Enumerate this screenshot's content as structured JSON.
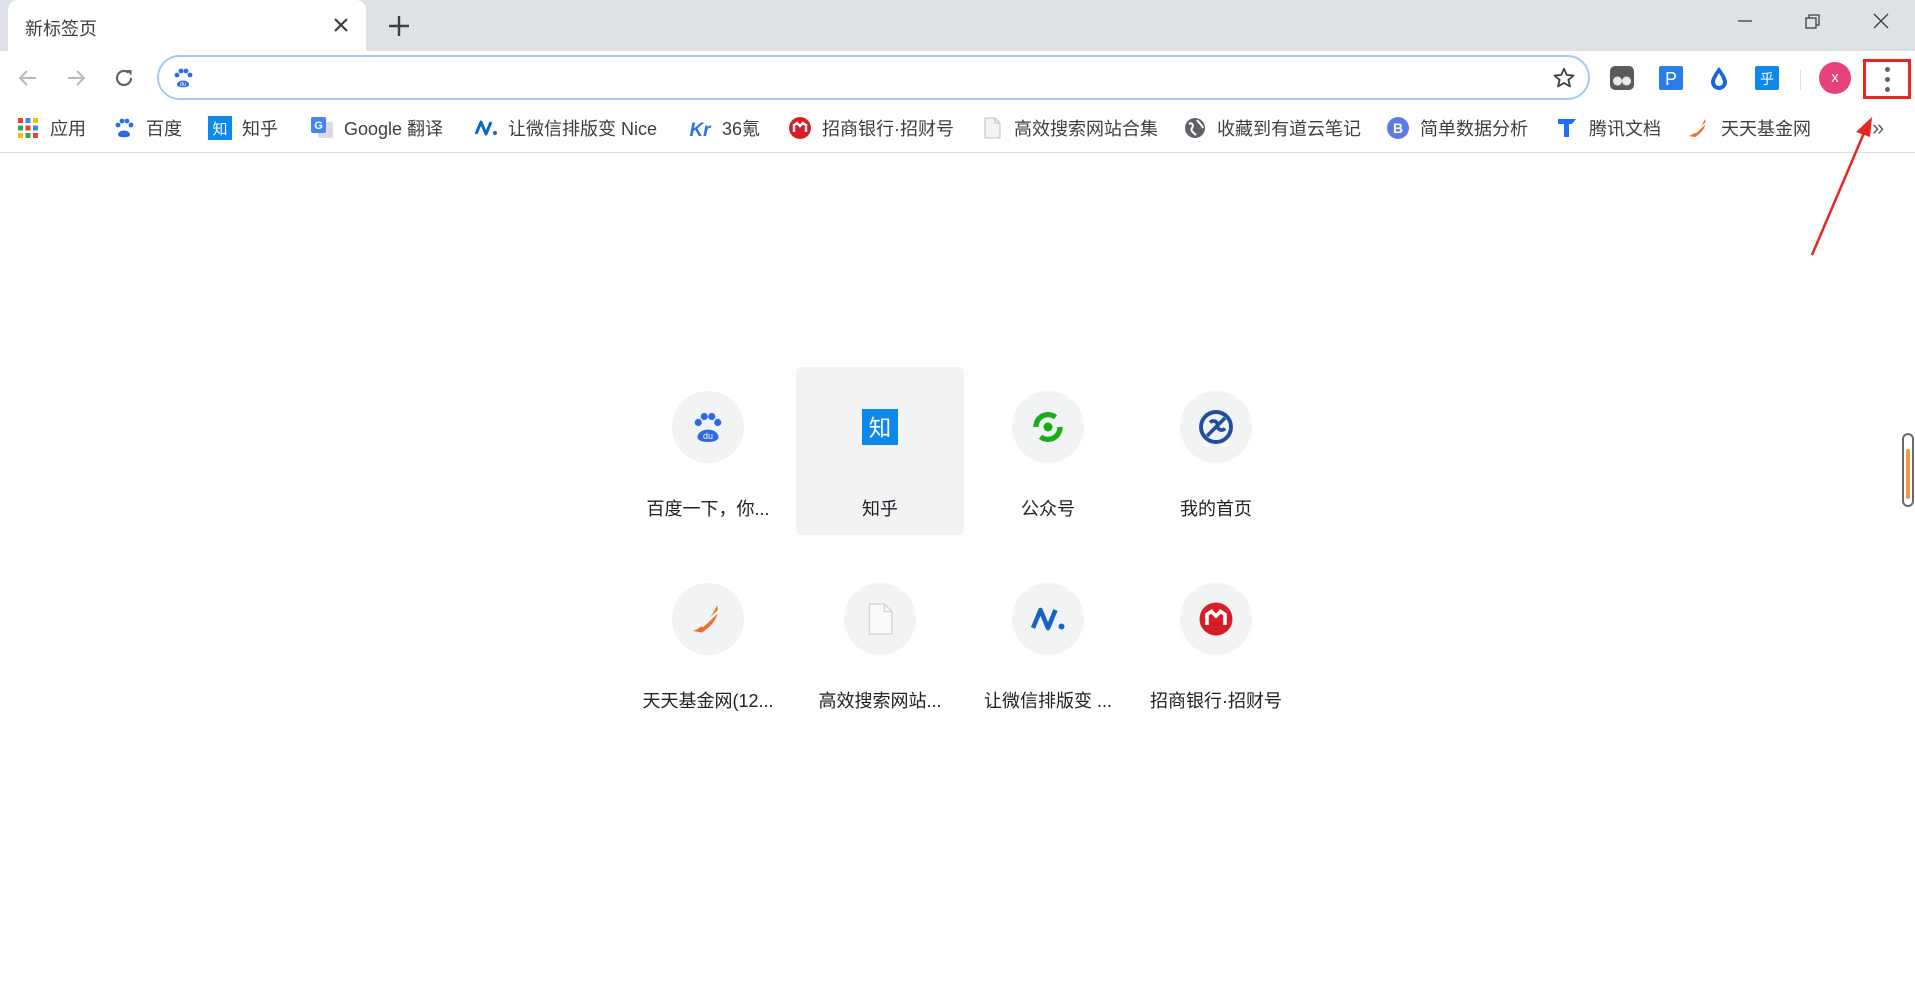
{
  "tab": {
    "title": "新标签页"
  },
  "omnibox": {
    "value": "",
    "placeholder": ""
  },
  "profile": {
    "initial": "x",
    "color": "#e7417a"
  },
  "bookmarks": [
    {
      "label": "应用",
      "icon": "apps-grid-icon"
    },
    {
      "label": "百度",
      "icon": "baidu-icon"
    },
    {
      "label": "知乎",
      "icon": "zhihu-icon"
    },
    {
      "label": "Google 翻译",
      "icon": "google-translate-icon"
    },
    {
      "label": "让微信排版变 Nice",
      "icon": "mdnice-icon"
    },
    {
      "label": "36氪",
      "icon": "36kr-icon"
    },
    {
      "label": "招商银行·招财号",
      "icon": "cmb-icon"
    },
    {
      "label": "高效搜索网站合集",
      "icon": "page-icon"
    },
    {
      "label": "收藏到有道云笔记",
      "icon": "globe-icon"
    },
    {
      "label": "简单数据分析",
      "icon": "b-icon"
    },
    {
      "label": "腾讯文档",
      "icon": "tencent-docs-icon"
    },
    {
      "label": "天天基金网",
      "icon": "tiantian-fund-icon"
    }
  ],
  "tiles": [
    {
      "label": "百度一下，你...",
      "icon": "baidu-icon"
    },
    {
      "label": "知乎",
      "icon": "zhihu-icon"
    },
    {
      "label": "公众号",
      "icon": "wechat-mp-icon"
    },
    {
      "label": "我的首页",
      "icon": "homepage-icon"
    },
    {
      "label": "天天基金网(12...",
      "icon": "tiantian-fund-icon"
    },
    {
      "label": "高效搜索网站...",
      "icon": "page-icon"
    },
    {
      "label": "让微信排版变 ...",
      "icon": "mdnice-icon"
    },
    {
      "label": "招商银行·招财号",
      "icon": "cmb-icon"
    }
  ],
  "colors": {
    "accent": "#1a73e8",
    "highlight_box": "#e8251f",
    "tab_strip": "#dee1e6"
  }
}
